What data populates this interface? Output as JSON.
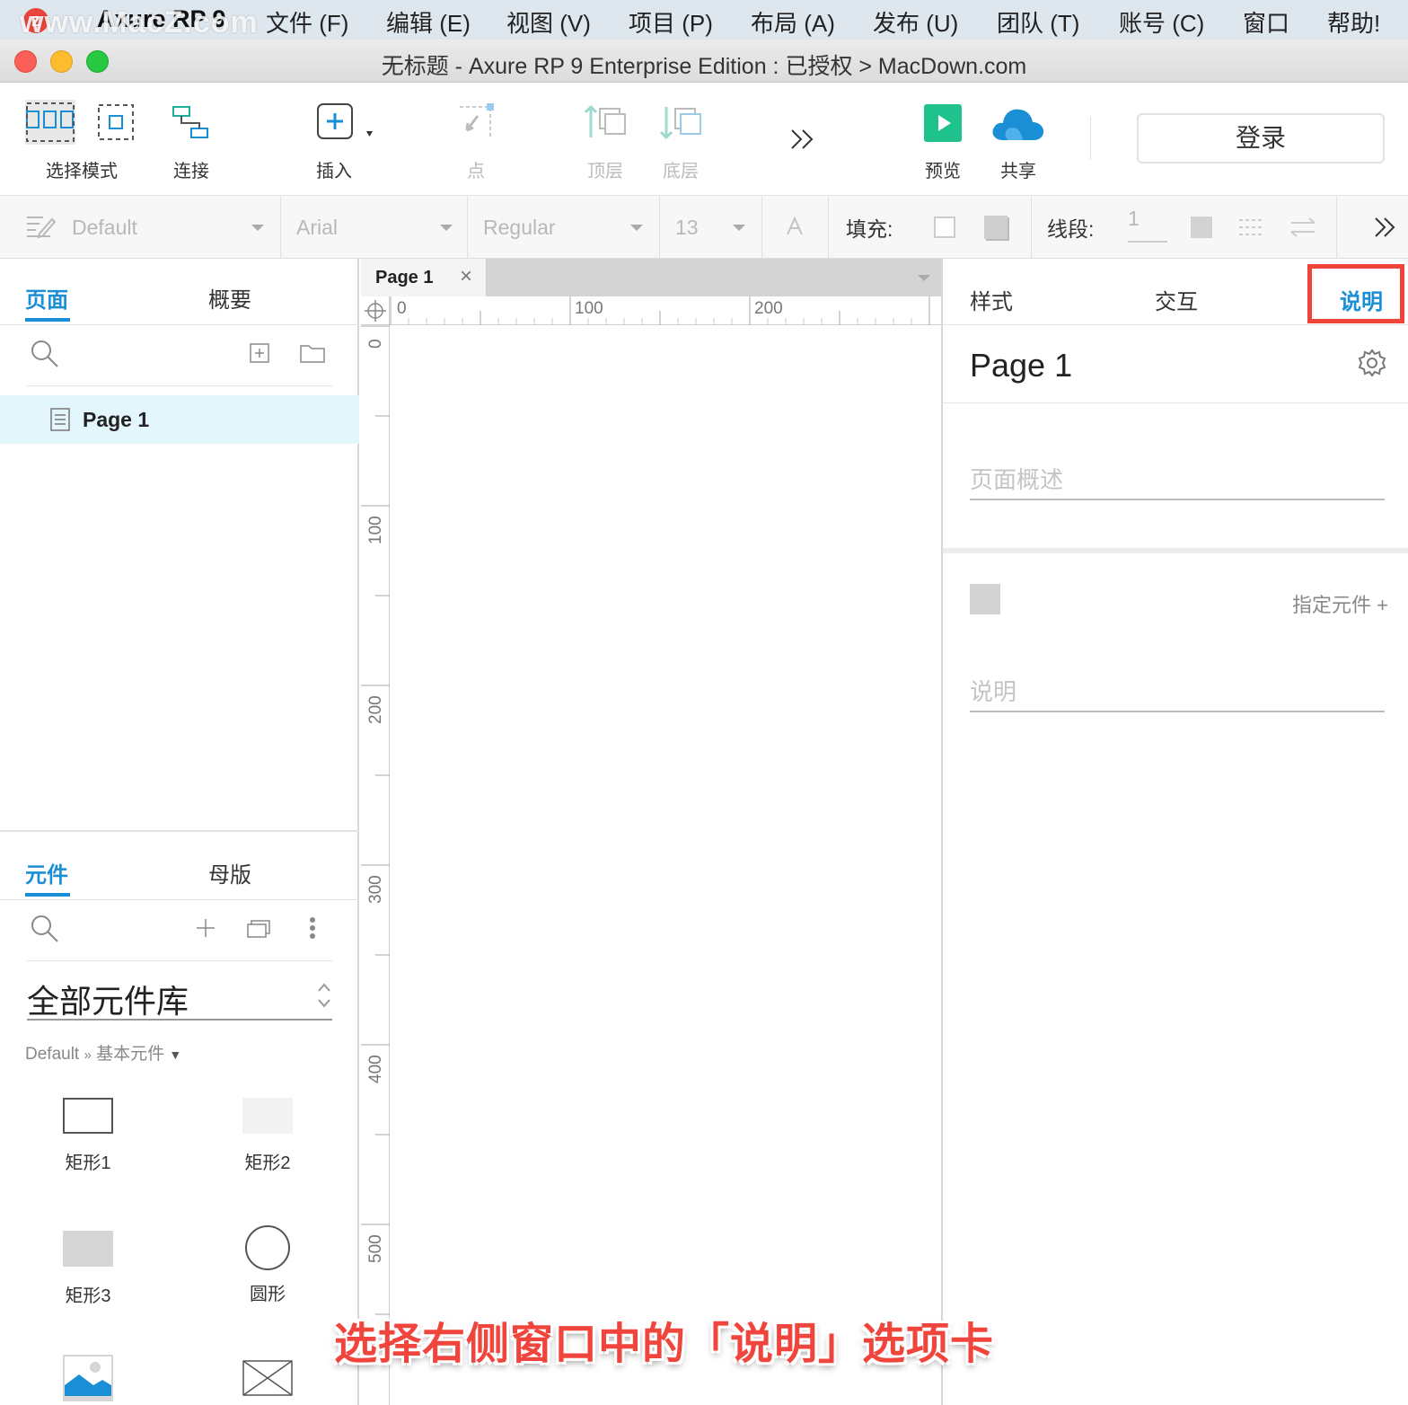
{
  "menubar": {
    "watermark": "www.MacZ.com",
    "app_name": "Axure RP 9",
    "items": [
      "文件 (F)",
      "编辑 (E)",
      "视图 (V)",
      "项目 (P)",
      "布局 (A)",
      "发布 (U)",
      "团队 (T)",
      "账号 (C)",
      "窗口",
      "帮助!"
    ]
  },
  "window": {
    "title": "无标题 - Axure RP 9 Enterprise Edition : 已授权 > MacDown.com"
  },
  "toolbar": {
    "select_mode": "选择模式",
    "connect": "连接",
    "insert": "插入",
    "point": "点",
    "top": "顶层",
    "bottom": "底层",
    "more": "»",
    "preview": "预览",
    "share": "共享",
    "login": "登录"
  },
  "formatbar": {
    "style": "Default",
    "font": "Arial",
    "weight": "Regular",
    "size": "13",
    "fill_label": "填充:",
    "line_label": "线段:",
    "line_width": "1"
  },
  "pages_panel": {
    "tabs": [
      "页面",
      "概要"
    ],
    "active_tab": "页面",
    "pages": [
      "Page 1"
    ]
  },
  "widgets_panel": {
    "tabs": [
      "元件",
      "母版"
    ],
    "active_tab": "元件",
    "library": "全部元件库",
    "path_root": "Default",
    "path_sep": "»",
    "path_leaf": "基本元件",
    "items": [
      "矩形1",
      "矩形2",
      "矩形3",
      "圆形"
    ]
  },
  "canvas": {
    "tab_title": "Page 1",
    "ruler_h": [
      "0",
      "100",
      "200"
    ],
    "ruler_v": [
      "0",
      "100",
      "200",
      "300",
      "400",
      "500"
    ]
  },
  "right_panel": {
    "tabs": [
      "样式",
      "交互",
      "说明"
    ],
    "active_tab": "说明",
    "page_title": "Page 1",
    "overview_placeholder": "页面概述",
    "assign_widget": "指定元件 +",
    "notes_placeholder": "说明"
  },
  "caption": "选择右侧窗口中的「说明」选项卡",
  "colors": {
    "accent": "#1a8fd6",
    "highlight": "#f0433a",
    "preview_green": "#1fc28c",
    "selected_page_bg": "#e2f6fb"
  }
}
